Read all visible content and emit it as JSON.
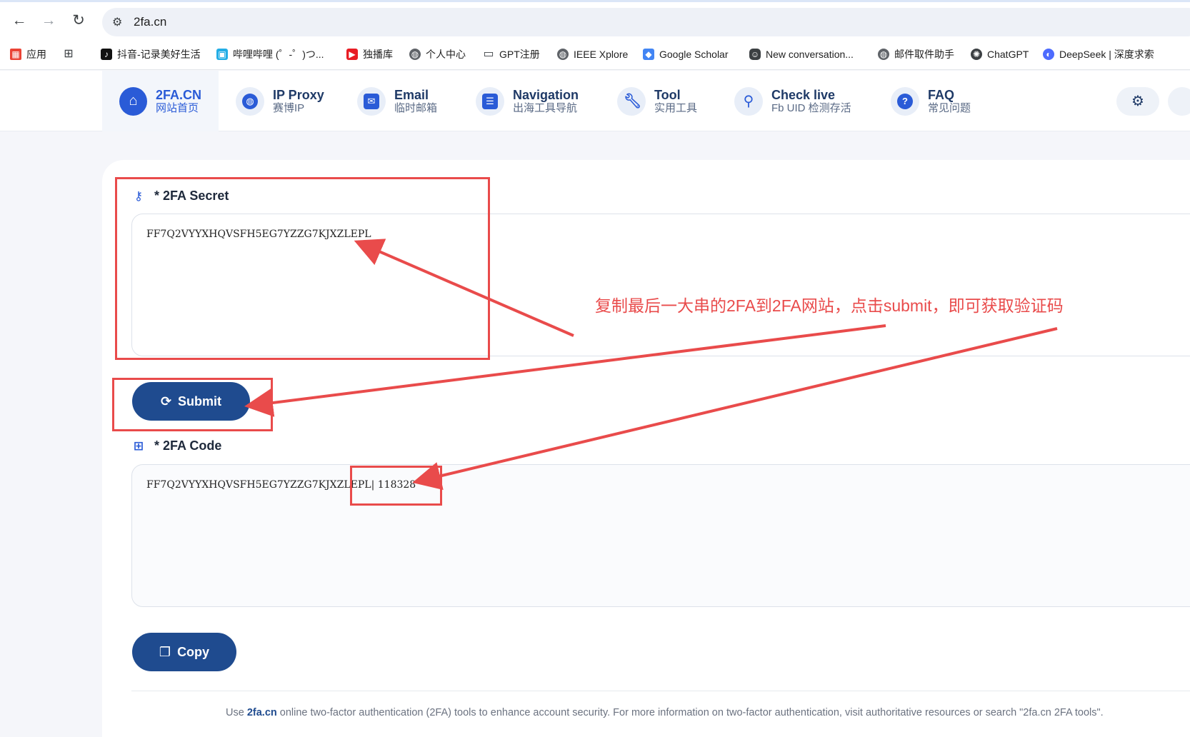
{
  "browser": {
    "url": "2fa.cn",
    "bookmarks": [
      {
        "label": "应用",
        "icon": "apps-grid-icon"
      },
      {
        "label": "",
        "icon": "tab-groups-icon"
      },
      {
        "label": "抖音-记录美好生活",
        "icon": "tiktok-icon"
      },
      {
        "label": "哔哩哔哩 (゜-゜)つ...",
        "icon": "bilibili-icon"
      },
      {
        "label": "独播库",
        "icon": "play-icon"
      },
      {
        "label": "个人中心",
        "icon": "globe-icon"
      },
      {
        "label": "GPT注册",
        "icon": "folder-icon"
      },
      {
        "label": "IEEE Xplore",
        "icon": "globe-icon"
      },
      {
        "label": "Google Scholar",
        "icon": "scholar-icon"
      },
      {
        "label": "New conversation...",
        "icon": "bot-icon"
      },
      {
        "label": "邮件取件助手",
        "icon": "globe-icon"
      },
      {
        "label": "ChatGPT",
        "icon": "openai-icon"
      },
      {
        "label": "DeepSeek | 深度求索",
        "icon": "deepseek-icon"
      }
    ]
  },
  "nav": {
    "items": [
      {
        "title": "2FA.CN",
        "subtitle": "网站首页",
        "icon": "home-icon"
      },
      {
        "title": "IP Proxy",
        "subtitle": "赛博IP",
        "icon": "globe-icon"
      },
      {
        "title": "Email",
        "subtitle": "临时邮箱",
        "icon": "mail-icon"
      },
      {
        "title": "Navigation",
        "subtitle": "出海工具导航",
        "icon": "signpost-icon"
      },
      {
        "title": "Tool",
        "subtitle": "实用工具",
        "icon": "wrench-icon"
      },
      {
        "title": "Check live",
        "subtitle": "Fb UID 检测存活",
        "icon": "search-icon"
      },
      {
        "title": "FAQ",
        "subtitle": "常见问题",
        "icon": "question-icon"
      }
    ]
  },
  "form": {
    "secret_label": "* 2FA Secret",
    "secret_value": "FF7Q2VYYXHQVSFH5EG7YZZG7KJXZLEPL",
    "submit_label": "Submit",
    "code_label": "* 2FA Code",
    "code_value": "FF7Q2VYYXHQVSFH5EG7YZZG7KJXZLEPL| 118328",
    "copy_label": "Copy"
  },
  "footer": {
    "pre": "Use ",
    "site": "2fa.cn",
    "post": " online two-factor authentication (2FA) tools to enhance account security. For more information on two-factor authentication, visit authoritative resources or search \"2fa.cn 2FA tools\"."
  },
  "annotation": {
    "text": "复制最后一大串的2FA到2FA网站，点击submit，即可获取验证码",
    "color": "#e94b4b"
  }
}
